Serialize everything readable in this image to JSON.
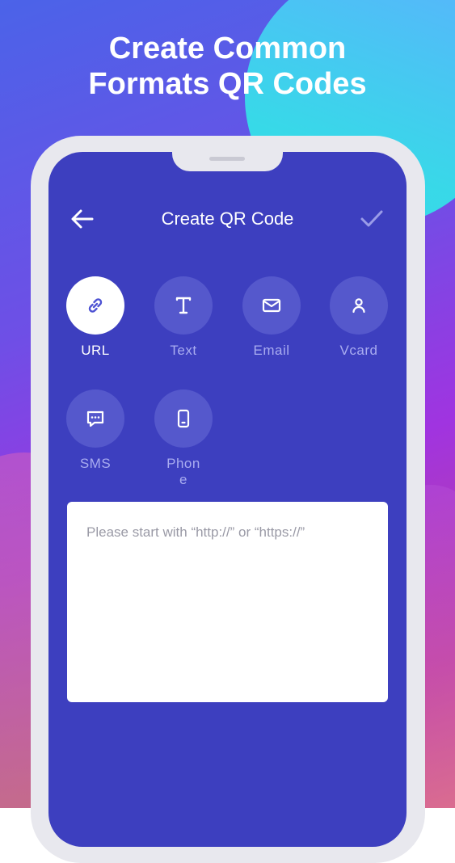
{
  "promo": {
    "headline_line1": "Create Common",
    "headline_line2": "Formats QR Codes"
  },
  "colors": {
    "screen_bg": "#3d3fbf",
    "active_circle": "#ffffff",
    "inactive_circle": "#5558cc",
    "active_icon": "#4d52d3",
    "inactive_label": "#a9acf0"
  },
  "topbar": {
    "title": "Create QR Code",
    "back_icon": "arrow-left-icon",
    "confirm_icon": "check-icon"
  },
  "types": [
    {
      "label": "URL",
      "icon": "link-icon",
      "active": true
    },
    {
      "label": "Text",
      "icon": "text-icon",
      "active": false
    },
    {
      "label": "Email",
      "icon": "mail-icon",
      "active": false
    },
    {
      "label": "Vcard",
      "icon": "person-icon",
      "active": false
    },
    {
      "label": "SMS",
      "icon": "message-icon",
      "active": false
    },
    {
      "label": "Phone",
      "icon": "phone-icon",
      "active": false
    }
  ],
  "input": {
    "placeholder": "Please start with “http://” or “https://”",
    "value": ""
  }
}
